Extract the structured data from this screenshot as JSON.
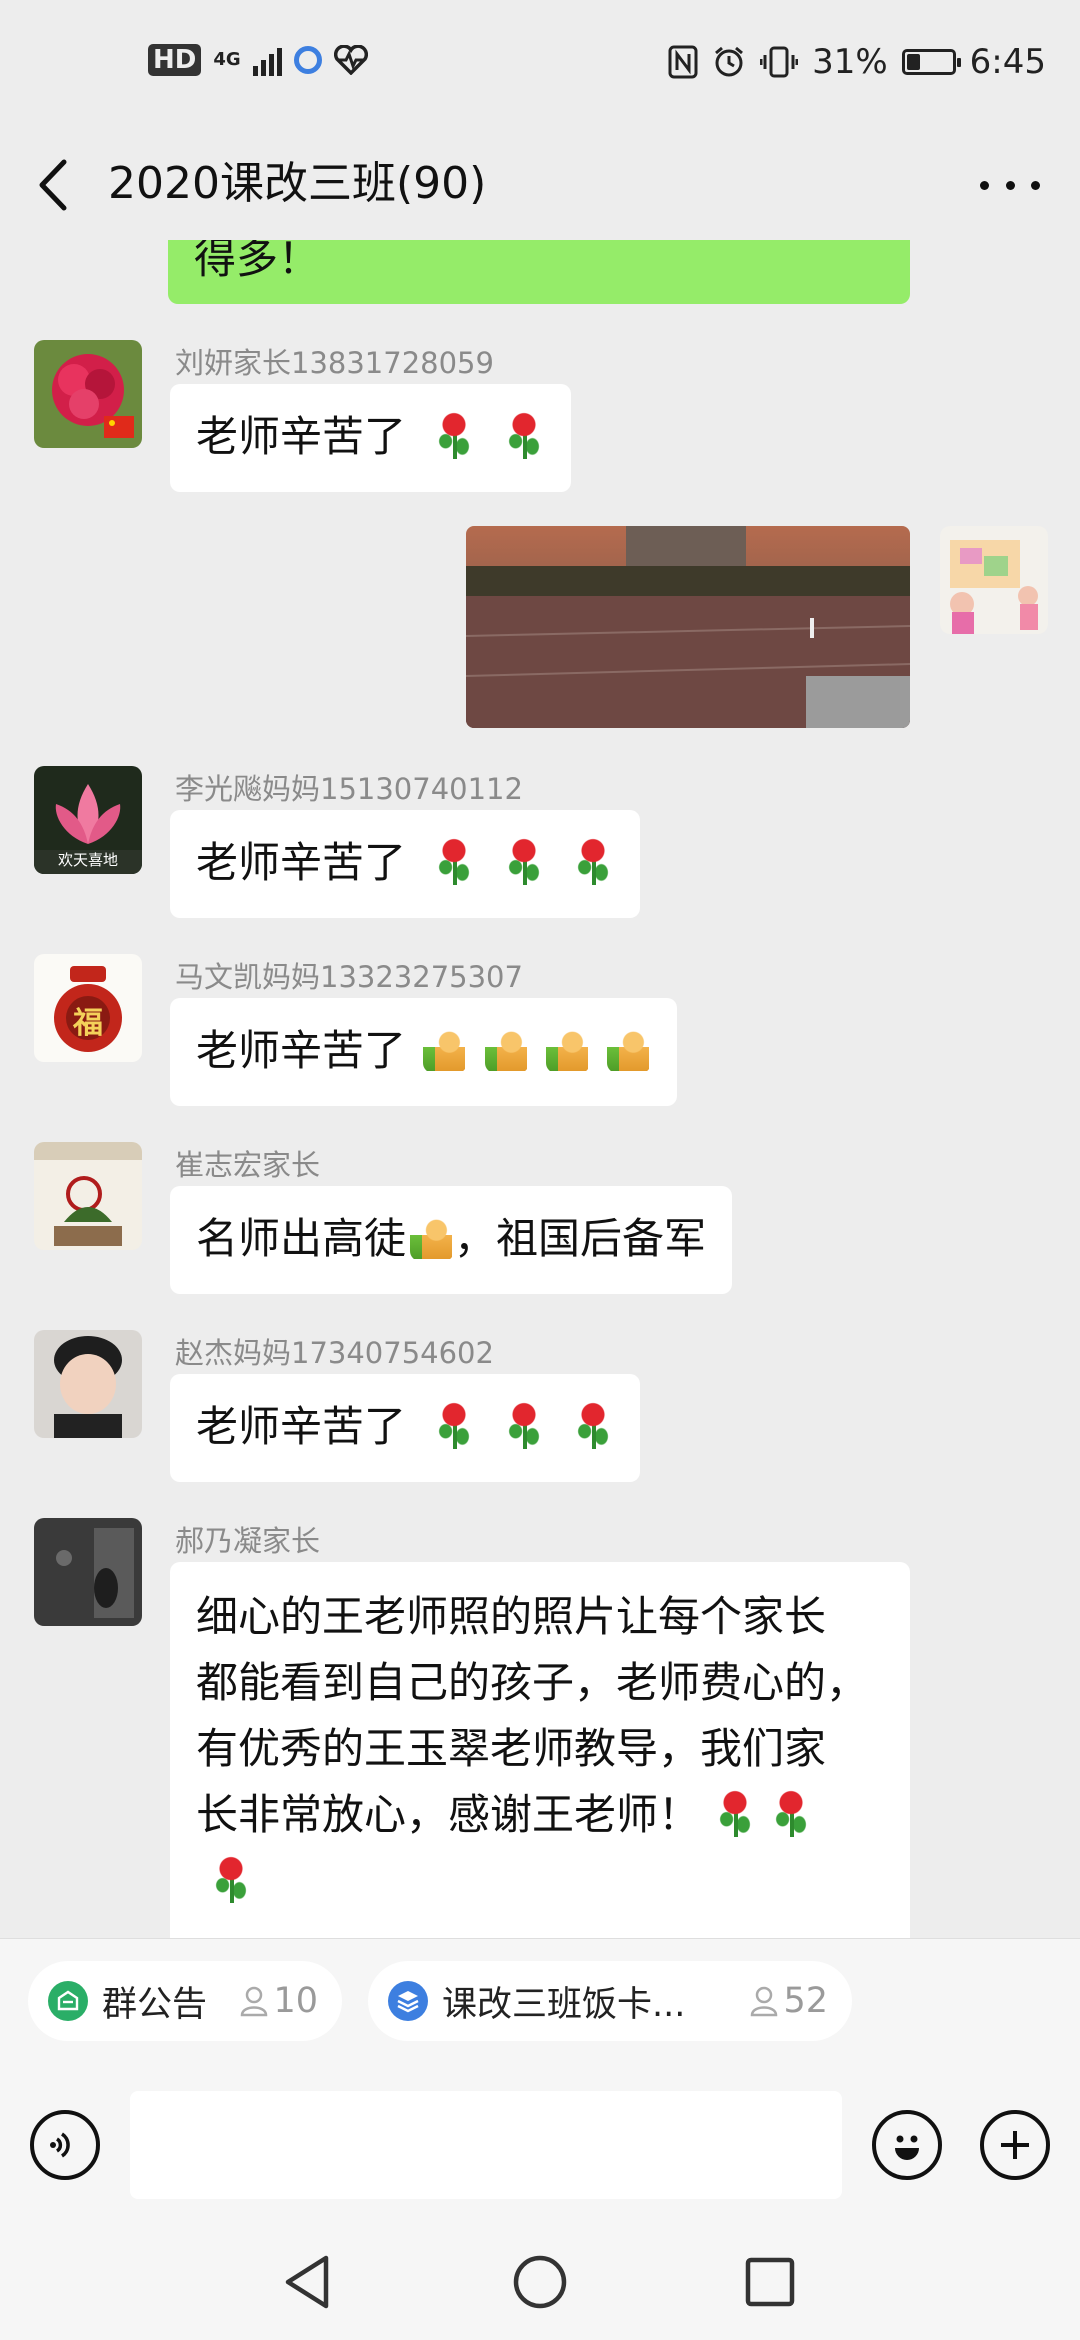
{
  "status_bar": {
    "hd": "HD",
    "network": "4G",
    "battery_percent": "31%",
    "battery_level": 0.31,
    "time": "6:45"
  },
  "header": {
    "title": "2020课改三班(90)"
  },
  "messages": [
    {
      "type": "text",
      "side": "right",
      "text": "得多！"
    },
    {
      "type": "text",
      "side": "left",
      "sender": "刘妍家长13831728059",
      "text": "老师辛苦了",
      "emoji": [
        "rose",
        "rose"
      ]
    },
    {
      "type": "image",
      "side": "right"
    },
    {
      "type": "text",
      "side": "left",
      "sender": "李光飚妈妈15130740112",
      "text": "老师辛苦了",
      "emoji": [
        "rose",
        "rose",
        "rose"
      ],
      "avatar_caption": "欢天喜地"
    },
    {
      "type": "text",
      "side": "left",
      "sender": "马文凯妈妈13323275307",
      "text": "老师辛苦了",
      "emoji": [
        "thumbs-up",
        "thumbs-up",
        "thumbs-up",
        "thumbs-up"
      ],
      "avatar_caption": "福"
    },
    {
      "type": "text",
      "side": "left",
      "sender": "崔志宏家长",
      "text_before": "名师出高徒",
      "emoji": [
        "thumbs-up"
      ],
      "text_after": "，祖国后备军"
    },
    {
      "type": "text",
      "side": "left",
      "sender": "赵杰妈妈17340754602",
      "text": "老师辛苦了",
      "emoji": [
        "rose",
        "rose",
        "rose"
      ]
    },
    {
      "type": "text",
      "side": "left",
      "sender": "郝乃凝家长",
      "lines": [
        "细心的王老师照的照片让每个家长",
        "都能看到自己的孩子，老师费心的，",
        "有优秀的王玉翠老师教导，我们家",
        "长非常放心，感谢王老师！"
      ],
      "emoji": [
        "rose",
        "rose",
        "rose"
      ]
    }
  ],
  "notices": [
    {
      "label": "群公告",
      "count": "10",
      "icon": "announcement-icon",
      "color": "#2aae67"
    },
    {
      "label": "课改三班饭卡...",
      "count": "52",
      "icon": "stack-icon",
      "color": "#3d7fe0"
    }
  ],
  "input": {
    "placeholder": ""
  },
  "colors": {
    "background": "#ededed",
    "my_bubble": "#95ec69",
    "other_bubble": "#ffffff"
  }
}
